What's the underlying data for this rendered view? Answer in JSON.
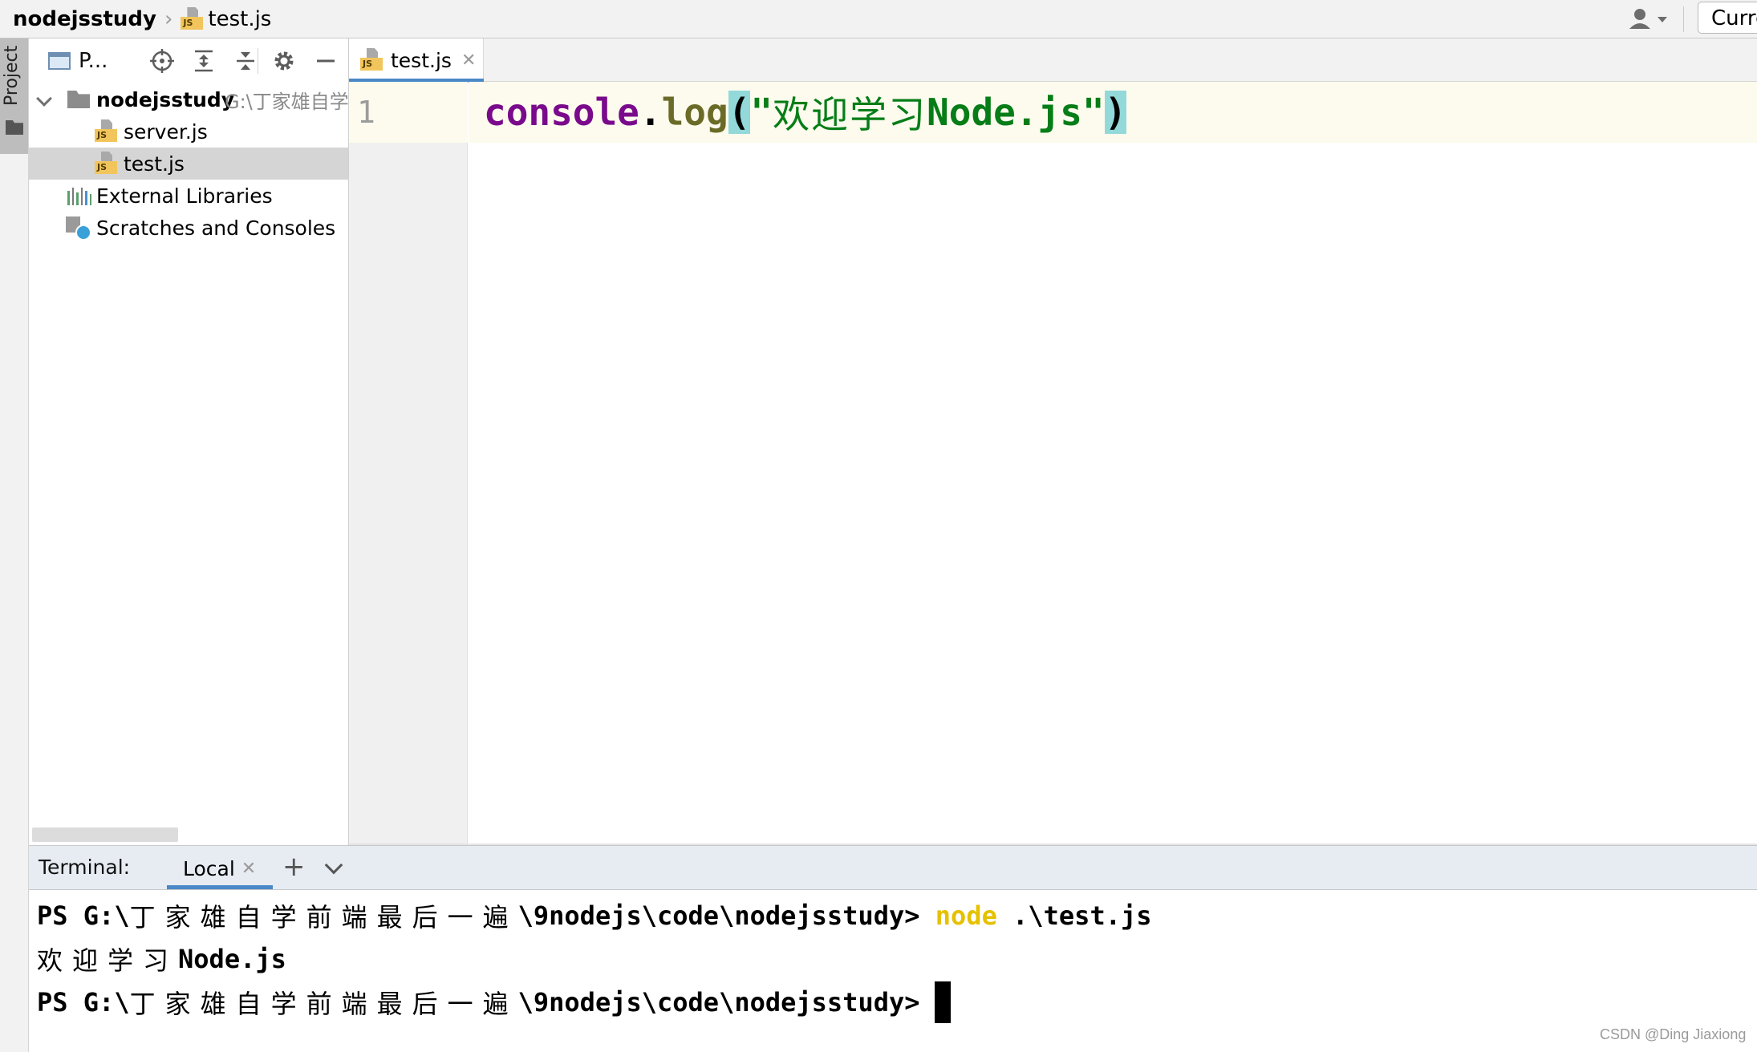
{
  "navbar": {
    "project_name": "nodejsstudy",
    "file_name": "test.js",
    "run_config_label": "Curre"
  },
  "left_strip": {
    "project_tab_label": "Project"
  },
  "project_panel": {
    "title": "P...",
    "tree": {
      "root": {
        "name": "nodejsstudy",
        "path": "G:\\丁家雄自学"
      },
      "files": [
        "server.js",
        "test.js"
      ],
      "external_libraries": "External Libraries",
      "scratches": "Scratches and Consoles"
    }
  },
  "editor": {
    "tab_label": "test.js",
    "line_number": "1",
    "code": {
      "object": "console",
      "dot": ".",
      "function": "log",
      "open_paren": "(",
      "quote_open": "\"",
      "string_cjk": "欢迎学习",
      "string_latin": "Node.js",
      "quote_close": "\"",
      "close_paren": ")"
    }
  },
  "terminal": {
    "title": "Terminal:",
    "tab_label": "Local",
    "lines": {
      "prompt1_prefix": "PS G:\\",
      "prompt1_cjk": "丁家雄自学前端最后一遍",
      "prompt1_suffix": "\\9nodejs\\code\\nodejsstudy> ",
      "command": "node",
      "command_arg": " .\\test.js",
      "output_cjk": "欢迎学习",
      "output_latin": "Node.js",
      "prompt2_prefix": "PS G:\\",
      "prompt2_cjk": "丁家雄自学前端最后一遍",
      "prompt2_suffix": "\\9nodejs\\code\\nodejsstudy>"
    }
  },
  "watermark": "CSDN @Ding Jiaxiong",
  "colors": {
    "accent": "#4a88c7",
    "keyword_object": "#7a0a8c",
    "string": "#067d17",
    "command": "#e5c100"
  }
}
